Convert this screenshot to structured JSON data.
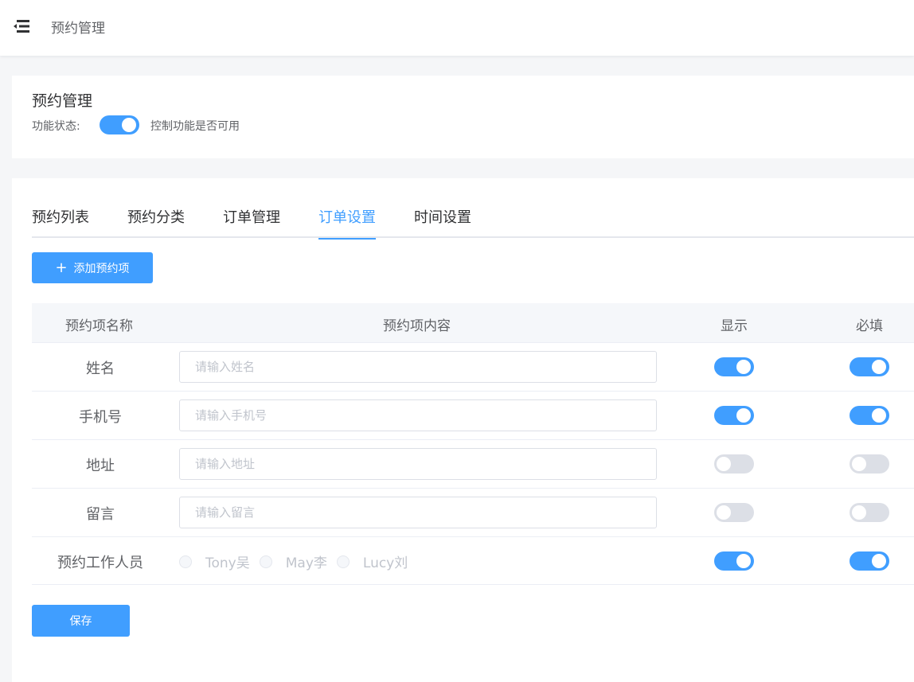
{
  "header": {
    "title": "预约管理",
    "menu_icon": "menu-fold-icon"
  },
  "feature": {
    "title": "预约管理",
    "status_label": "功能状态:",
    "status_on": true,
    "status_hint": "控制功能是否可用"
  },
  "tabs": [
    {
      "label": "预约列表",
      "active": false
    },
    {
      "label": "预约分类",
      "active": false
    },
    {
      "label": "订单管理",
      "active": false
    },
    {
      "label": "订单设置",
      "active": true
    },
    {
      "label": "时间设置",
      "active": false
    }
  ],
  "add_button": {
    "label": "添加预约项",
    "icon": "plus-icon"
  },
  "table": {
    "headers": {
      "name": "预约项名称",
      "content": "预约项内容",
      "show": "显示",
      "required": "必填"
    },
    "rows": [
      {
        "name": "姓名",
        "placeholder": "请输入姓名",
        "show": true,
        "required": true
      },
      {
        "name": "手机号",
        "placeholder": "请输入手机号",
        "show": true,
        "required": true
      },
      {
        "name": "地址",
        "placeholder": "请输入地址",
        "show": false,
        "required": false
      },
      {
        "name": "留言",
        "placeholder": "请输入留言",
        "show": false,
        "required": false
      }
    ],
    "staff_row": {
      "name": "预约工作人员",
      "options": [
        "Tony吴",
        "May李",
        "Lucy刘"
      ],
      "show": true,
      "required": true
    }
  },
  "save_button": {
    "label": "保存"
  },
  "colors": {
    "accent": "#409eff",
    "switch_off": "#dcdfe6"
  }
}
